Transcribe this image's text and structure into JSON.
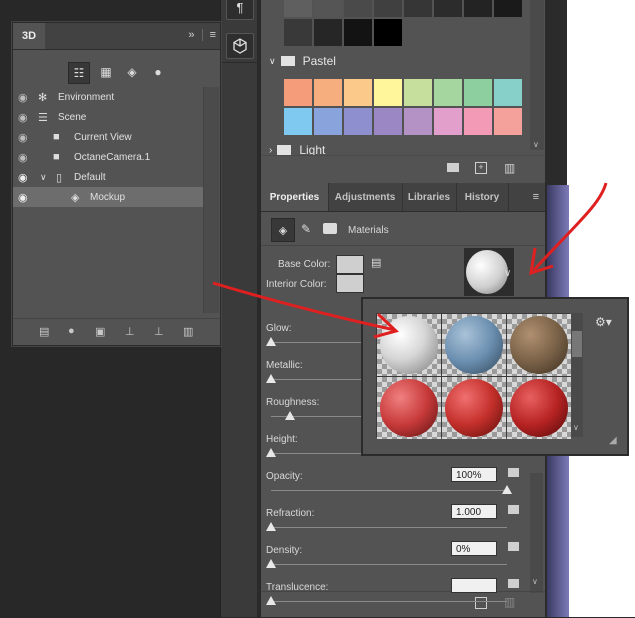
{
  "panel3d": {
    "tab": "3D",
    "collapse_glyph": "»",
    "menu_glyph": "≡",
    "filters": [
      "whole-scene",
      "meshes",
      "materials",
      "lights"
    ],
    "tree": [
      {
        "label": "Environment",
        "visible": true
      },
      {
        "label": "Scene",
        "visible": true
      },
      {
        "label": "Current View",
        "visible": true
      },
      {
        "label": "OctaneCamera.1",
        "visible": true
      },
      {
        "label": "Default",
        "visible": true
      },
      {
        "label": "Mockup",
        "visible": true,
        "selected": true
      }
    ],
    "footer_icons": [
      "scene-icon",
      "light-add-icon",
      "mesh-icon",
      "ground-icon",
      "light-ground-icon",
      "trash-icon"
    ]
  },
  "swatches": {
    "groups": [
      {
        "label": "Pastel"
      },
      {
        "label": "Light"
      }
    ],
    "gray_row1": [
      "#5f5f5f",
      "#555555",
      "#4a4a4a",
      "#404040",
      "#363636",
      "#2c2c2c",
      "#232323",
      "#1a1a1a"
    ],
    "gray_row2": [
      "#393939",
      "#262626",
      "#131313",
      "#000000"
    ],
    "pastel_row1": [
      "#f59d7a",
      "#f7ae7e",
      "#fbc98a",
      "#fff59a",
      "#c6df9c",
      "#a5d6a0",
      "#8ecf9f",
      "#87cfc9"
    ],
    "pastel_row2": [
      "#7fc8f0",
      "#89a3dd",
      "#8d8fce",
      "#9a87c3",
      "#b592c6",
      "#e29fcc",
      "#f39bb6",
      "#f4a09b"
    ]
  },
  "properties": {
    "tabs": [
      "Properties",
      "Adjustments",
      "Libraries",
      "History"
    ],
    "section": "Materials",
    "base_color_label": "Base Color:",
    "interior_color_label": "Interior Color:",
    "sliders": [
      {
        "label": "Glow:",
        "value": "",
        "level": 0
      },
      {
        "label": "Metallic:",
        "value": "",
        "level": 0
      },
      {
        "label": "Roughness:",
        "value": "",
        "level": 0.2
      },
      {
        "label": "Height:",
        "value": "",
        "level": 0
      },
      {
        "label": "Opacity:",
        "value": "100%",
        "level": 1
      },
      {
        "label": "Refraction:",
        "value": "1.000",
        "level": 0
      },
      {
        "label": "Density:",
        "value": "0%",
        "level": 0
      },
      {
        "label": "Translucence:",
        "value": "",
        "level": 0
      }
    ]
  },
  "picker": {
    "materials": [
      {
        "name": "white-plastic",
        "color": "#e8e8e8"
      },
      {
        "name": "blue-matte",
        "color": "#6b8fb0"
      },
      {
        "name": "wood",
        "color": "#7a6248"
      },
      {
        "name": "red-fabric",
        "color": "#c83a3a"
      },
      {
        "name": "red-leather",
        "color": "#c4302b"
      },
      {
        "name": "red-knit",
        "color": "#b72323"
      }
    ],
    "gear": "⚙▾"
  },
  "colors": {
    "annotation_red": "#e02020",
    "panel_bg": "#535353",
    "tab_bar": "#424242"
  }
}
